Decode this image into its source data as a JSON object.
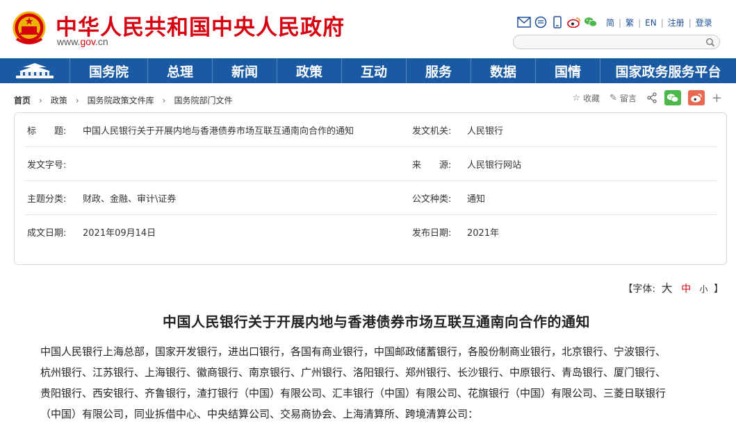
{
  "header": {
    "site_title": "中华人民共和国中央人民政府",
    "url_prefix": "www.",
    "url_gov": "gov",
    "url_suffix": ".cn",
    "lang_links": [
      "简",
      "繁",
      "EN",
      "注册",
      "登录"
    ],
    "icons": [
      "mail-icon",
      "message-icon",
      "mobile-icon",
      "weibo-icon",
      "wechat-icon"
    ],
    "search_placeholder": ""
  },
  "nav": {
    "items": [
      "国务院",
      "总理",
      "新闻",
      "政策",
      "互动",
      "服务",
      "数据",
      "国情",
      "国家政务服务平台"
    ]
  },
  "breadcrumb": {
    "items": [
      "首页",
      "政策",
      "国务院政策文件库",
      "国务院部门文件"
    ]
  },
  "tools": {
    "favorite": "收藏",
    "comment": "留言"
  },
  "info": {
    "title_label": "标　　题:",
    "title_value": "中国人民银行关于开展内地与香港债券市场互联互通南向合作的通知",
    "issuer_label": "发文机关:",
    "issuer_value": "人民银行",
    "docno_label": "发文字号:",
    "docno_value": "",
    "source_label": "来　　源:",
    "source_value": "人民银行网站",
    "topic_label": "主题分类:",
    "topic_value": "财政、金融、审计\\证券",
    "type_label": "公文种类:",
    "type_value": "通知",
    "written_label": "成文日期:",
    "written_value": "2021年09月14日",
    "published_label": "发布日期:",
    "published_value": "2021年"
  },
  "fontsize": {
    "prefix": "【字体:",
    "large": "大",
    "medium": "中",
    "small": "小",
    "suffix": "】"
  },
  "article": {
    "title": "中国人民银行关于开展内地与香港债券市场互联互通南向合作的通知",
    "lines": [
      "中国人民银行上海总部，国家开发银行，进出口银行，各国有商业银行，中国邮政储蓄银行，各股份制商业银行，北京银行、宁波银行、",
      "杭州银行、江苏银行、上海银行、徽商银行、南京银行、广州银行、洛阳银行、郑州银行、长沙银行、中原银行、青岛银行、厦门银行、",
      "贵阳银行、西安银行、齐鲁银行，渣打银行（中国）有限公司、汇丰银行（中国）有限公司、花旗银行（中国）有限公司、三菱日联银行",
      "（中国）有限公司，同业拆借中心、中央结算公司、交易商协会、上海清算所、跨境清算公司："
    ]
  },
  "colors": {
    "brand_red": "#d6000f",
    "nav_blue": "#1a5aa3",
    "link_blue": "#1a4e99"
  }
}
